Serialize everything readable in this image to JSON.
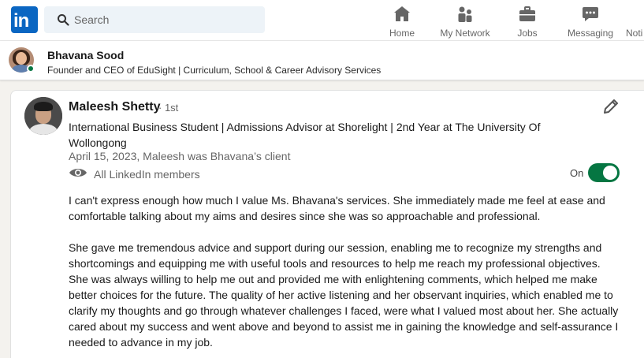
{
  "nav": {
    "logo_text": "in",
    "search_placeholder": "Search",
    "items": [
      {
        "label": "Home",
        "icon": "home-icon"
      },
      {
        "label": "My Network",
        "icon": "network-icon"
      },
      {
        "label": "Jobs",
        "icon": "briefcase-icon"
      },
      {
        "label": "Messaging",
        "icon": "messaging-icon"
      },
      {
        "label": "Noti",
        "icon": "bell-icon"
      }
    ]
  },
  "profile_bar": {
    "name": "Bhavana Sood",
    "headline": "Founder and CEO of EduSight | Curriculum, School & Career Advisory Services"
  },
  "recommendation": {
    "name": "Maleesh Shetty",
    "degree": "· 1st",
    "headline": "International Business Student | Admissions Advisor at Shorelight | 2nd Year at The University Of Wollongong",
    "date_relation": "April 15, 2023, Maleesh was Bhavana’s client",
    "visibility": "All LinkedIn members",
    "toggle_label": "On",
    "toggle_on": true,
    "paragraph_1": "I can't express enough how much I value Ms. Bhavana's services. She immediately made me feel at ease and comfortable talking about my aims and desires since she was so approachable and professional.",
    "paragraph_2": "She gave me tremendous advice and support during our session, enabling me to recognize my strengths and shortcomings and equipping me with useful tools and resources to help me reach my professional objectives. She was always willing to help me out and provided me with enlightening comments, which helped me make better choices for the future. The quality of her active listening and her observant inquiries, which enabled me to clarify my thoughts and go through whatever challenges I faced, were what I valued most about her. She actually cared about my success and went above and beyond to assist me in gaining the knowledge and self-assurance I needed to advance in my job."
  },
  "colors": {
    "brand": "#0a66c2",
    "toggle_on": "#057642",
    "search_bg": "#edf3f8"
  }
}
